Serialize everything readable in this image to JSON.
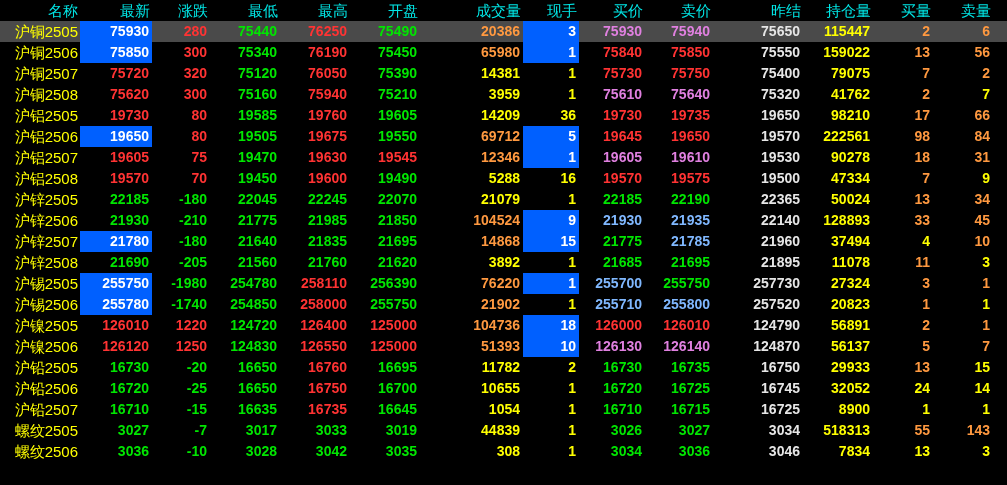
{
  "columns": [
    "名称",
    "最新",
    "涨跌",
    "最低",
    "最高",
    "开盘",
    "成交量",
    "现手",
    "买价",
    "卖价",
    "昨结",
    "持仓量",
    "买量",
    "卖量"
  ],
  "rows": [
    {
      "name": "沪铜2505",
      "selected": true,
      "latest_highlighted": true,
      "hand_highlighted": true,
      "cells": [
        {
          "text": "75930",
          "color": "#ffffff"
        },
        {
          "text": "280",
          "color": "#ff3333"
        },
        {
          "text": "75440",
          "color": "#00e600"
        },
        {
          "text": "76250",
          "color": "#ff3333"
        },
        {
          "text": "75490",
          "color": "#00e600"
        },
        {
          "text": "20386",
          "color": "#ff9940"
        },
        {
          "text": "3",
          "color": "#ffffff"
        },
        {
          "text": "75930",
          "color": "#e080e0"
        },
        {
          "text": "75940",
          "color": "#e080e0"
        },
        {
          "text": "75650",
          "color": "#e6e6e6"
        },
        {
          "text": "115447",
          "color": "#ffff00"
        },
        {
          "text": "2",
          "color": "#ff9940"
        },
        {
          "text": "6",
          "color": "#ff9940"
        }
      ]
    },
    {
      "name": "沪铜2506",
      "selected": false,
      "latest_highlighted": true,
      "hand_highlighted": true,
      "cells": [
        {
          "text": "75850",
          "color": "#ffffff"
        },
        {
          "text": "300",
          "color": "#ff3333"
        },
        {
          "text": "75340",
          "color": "#00e600"
        },
        {
          "text": "76190",
          "color": "#ff3333"
        },
        {
          "text": "75450",
          "color": "#00e600"
        },
        {
          "text": "65980",
          "color": "#ff9940"
        },
        {
          "text": "1",
          "color": "#ffffff"
        },
        {
          "text": "75840",
          "color": "#ff3333"
        },
        {
          "text": "75850",
          "color": "#ff3333"
        },
        {
          "text": "75550",
          "color": "#e6e6e6"
        },
        {
          "text": "159022",
          "color": "#ffff00"
        },
        {
          "text": "13",
          "color": "#ff9940"
        },
        {
          "text": "56",
          "color": "#ff9940"
        }
      ]
    },
    {
      "name": "沪铜2507",
      "selected": false,
      "latest_highlighted": false,
      "hand_highlighted": false,
      "cells": [
        {
          "text": "75720",
          "color": "#ff3333"
        },
        {
          "text": "320",
          "color": "#ff3333"
        },
        {
          "text": "75120",
          "color": "#00e600"
        },
        {
          "text": "76050",
          "color": "#ff3333"
        },
        {
          "text": "75390",
          "color": "#00e600"
        },
        {
          "text": "14381",
          "color": "#ffff00"
        },
        {
          "text": "1",
          "color": "#ffff00"
        },
        {
          "text": "75730",
          "color": "#ff3333"
        },
        {
          "text": "75750",
          "color": "#ff3333"
        },
        {
          "text": "75400",
          "color": "#e6e6e6"
        },
        {
          "text": "79075",
          "color": "#ffff00"
        },
        {
          "text": "7",
          "color": "#ff9940"
        },
        {
          "text": "2",
          "color": "#ff9940"
        }
      ]
    },
    {
      "name": "沪铜2508",
      "selected": false,
      "latest_highlighted": false,
      "hand_highlighted": false,
      "cells": [
        {
          "text": "75620",
          "color": "#ff3333"
        },
        {
          "text": "300",
          "color": "#ff3333"
        },
        {
          "text": "75160",
          "color": "#00e600"
        },
        {
          "text": "75940",
          "color": "#ff3333"
        },
        {
          "text": "75210",
          "color": "#00e600"
        },
        {
          "text": "3959",
          "color": "#ffff00"
        },
        {
          "text": "1",
          "color": "#ffff00"
        },
        {
          "text": "75610",
          "color": "#e080e0"
        },
        {
          "text": "75640",
          "color": "#e080e0"
        },
        {
          "text": "75320",
          "color": "#e6e6e6"
        },
        {
          "text": "41762",
          "color": "#ffff00"
        },
        {
          "text": "2",
          "color": "#ff9940"
        },
        {
          "text": "7",
          "color": "#ffff00"
        }
      ]
    },
    {
      "name": "沪铝2505",
      "selected": false,
      "latest_highlighted": false,
      "hand_highlighted": false,
      "cells": [
        {
          "text": "19730",
          "color": "#ff3333"
        },
        {
          "text": "80",
          "color": "#ff3333"
        },
        {
          "text": "19585",
          "color": "#00e600"
        },
        {
          "text": "19760",
          "color": "#ff3333"
        },
        {
          "text": "19605",
          "color": "#00e600"
        },
        {
          "text": "14209",
          "color": "#ffff00"
        },
        {
          "text": "36",
          "color": "#ffff00"
        },
        {
          "text": "19730",
          "color": "#ff3333"
        },
        {
          "text": "19735",
          "color": "#ff3333"
        },
        {
          "text": "19650",
          "color": "#e6e6e6"
        },
        {
          "text": "98210",
          "color": "#ffff00"
        },
        {
          "text": "17",
          "color": "#ff9940"
        },
        {
          "text": "66",
          "color": "#ff9940"
        }
      ]
    },
    {
      "name": "沪铝2506",
      "selected": false,
      "latest_highlighted": true,
      "hand_highlighted": true,
      "cells": [
        {
          "text": "19650",
          "color": "#ffffff"
        },
        {
          "text": "80",
          "color": "#ff3333"
        },
        {
          "text": "19505",
          "color": "#00e600"
        },
        {
          "text": "19675",
          "color": "#ff3333"
        },
        {
          "text": "19550",
          "color": "#00e600"
        },
        {
          "text": "69712",
          "color": "#ff9940"
        },
        {
          "text": "5",
          "color": "#ffffff"
        },
        {
          "text": "19645",
          "color": "#ff3333"
        },
        {
          "text": "19650",
          "color": "#ff3333"
        },
        {
          "text": "19570",
          "color": "#e6e6e6"
        },
        {
          "text": "222561",
          "color": "#ffff00"
        },
        {
          "text": "98",
          "color": "#ff9940"
        },
        {
          "text": "84",
          "color": "#ff9940"
        }
      ]
    },
    {
      "name": "沪铝2507",
      "selected": false,
      "latest_highlighted": false,
      "hand_highlighted": true,
      "cells": [
        {
          "text": "19605",
          "color": "#ff3333"
        },
        {
          "text": "75",
          "color": "#ff3333"
        },
        {
          "text": "19470",
          "color": "#00e600"
        },
        {
          "text": "19630",
          "color": "#ff3333"
        },
        {
          "text": "19545",
          "color": "#ff3333"
        },
        {
          "text": "12346",
          "color": "#ff9940"
        },
        {
          "text": "1",
          "color": "#ffffff"
        },
        {
          "text": "19605",
          "color": "#e080e0"
        },
        {
          "text": "19610",
          "color": "#e080e0"
        },
        {
          "text": "19530",
          "color": "#e6e6e6"
        },
        {
          "text": "90278",
          "color": "#ffff00"
        },
        {
          "text": "18",
          "color": "#ff9940"
        },
        {
          "text": "31",
          "color": "#ff9940"
        }
      ]
    },
    {
      "name": "沪铝2508",
      "selected": false,
      "latest_highlighted": false,
      "hand_highlighted": false,
      "cells": [
        {
          "text": "19570",
          "color": "#ff3333"
        },
        {
          "text": "70",
          "color": "#ff3333"
        },
        {
          "text": "19450",
          "color": "#00e600"
        },
        {
          "text": "19600",
          "color": "#ff3333"
        },
        {
          "text": "19490",
          "color": "#00e600"
        },
        {
          "text": "5288",
          "color": "#ffff00"
        },
        {
          "text": "16",
          "color": "#ffff00"
        },
        {
          "text": "19570",
          "color": "#ff3333"
        },
        {
          "text": "19575",
          "color": "#ff3333"
        },
        {
          "text": "19500",
          "color": "#e6e6e6"
        },
        {
          "text": "47334",
          "color": "#ffff00"
        },
        {
          "text": "7",
          "color": "#ff9940"
        },
        {
          "text": "9",
          "color": "#ffff00"
        }
      ]
    },
    {
      "name": "沪锌2505",
      "selected": false,
      "latest_highlighted": false,
      "hand_highlighted": false,
      "cells": [
        {
          "text": "22185",
          "color": "#00e600"
        },
        {
          "text": "-180",
          "color": "#00e600"
        },
        {
          "text": "22045",
          "color": "#00e600"
        },
        {
          "text": "22245",
          "color": "#00e600"
        },
        {
          "text": "22070",
          "color": "#00e600"
        },
        {
          "text": "21079",
          "color": "#ffff00"
        },
        {
          "text": "1",
          "color": "#ffff00"
        },
        {
          "text": "22185",
          "color": "#00e600"
        },
        {
          "text": "22190",
          "color": "#00e600"
        },
        {
          "text": "22365",
          "color": "#e6e6e6"
        },
        {
          "text": "50024",
          "color": "#ffff00"
        },
        {
          "text": "13",
          "color": "#ff9940"
        },
        {
          "text": "34",
          "color": "#ff9940"
        }
      ]
    },
    {
      "name": "沪锌2506",
      "selected": false,
      "latest_highlighted": false,
      "hand_highlighted": true,
      "cells": [
        {
          "text": "21930",
          "color": "#00e600"
        },
        {
          "text": "-210",
          "color": "#00e600"
        },
        {
          "text": "21775",
          "color": "#00e600"
        },
        {
          "text": "21985",
          "color": "#00e600"
        },
        {
          "text": "21850",
          "color": "#00e600"
        },
        {
          "text": "104524",
          "color": "#ff9940"
        },
        {
          "text": "9",
          "color": "#ffffff"
        },
        {
          "text": "21930",
          "color": "#80b8ff"
        },
        {
          "text": "21935",
          "color": "#80b8ff"
        },
        {
          "text": "22140",
          "color": "#e6e6e6"
        },
        {
          "text": "128893",
          "color": "#ffff00"
        },
        {
          "text": "33",
          "color": "#ff9940"
        },
        {
          "text": "45",
          "color": "#ff9940"
        }
      ]
    },
    {
      "name": "沪锌2507",
      "selected": false,
      "latest_highlighted": true,
      "hand_highlighted": true,
      "cells": [
        {
          "text": "21780",
          "color": "#ffffff"
        },
        {
          "text": "-180",
          "color": "#00e600"
        },
        {
          "text": "21640",
          "color": "#00e600"
        },
        {
          "text": "21835",
          "color": "#00e600"
        },
        {
          "text": "21695",
          "color": "#00e600"
        },
        {
          "text": "14868",
          "color": "#ff9940"
        },
        {
          "text": "15",
          "color": "#ffffff"
        },
        {
          "text": "21775",
          "color": "#00e600"
        },
        {
          "text": "21785",
          "color": "#80b8ff"
        },
        {
          "text": "21960",
          "color": "#e6e6e6"
        },
        {
          "text": "37494",
          "color": "#ffff00"
        },
        {
          "text": "4",
          "color": "#ffff00"
        },
        {
          "text": "10",
          "color": "#ff9940"
        }
      ]
    },
    {
      "name": "沪锌2508",
      "selected": false,
      "latest_highlighted": false,
      "hand_highlighted": false,
      "cells": [
        {
          "text": "21690",
          "color": "#00e600"
        },
        {
          "text": "-205",
          "color": "#00e600"
        },
        {
          "text": "21560",
          "color": "#00e600"
        },
        {
          "text": "21760",
          "color": "#00e600"
        },
        {
          "text": "21620",
          "color": "#00e600"
        },
        {
          "text": "3892",
          "color": "#ffff00"
        },
        {
          "text": "1",
          "color": "#ffff00"
        },
        {
          "text": "21685",
          "color": "#00e600"
        },
        {
          "text": "21695",
          "color": "#00e600"
        },
        {
          "text": "21895",
          "color": "#e6e6e6"
        },
        {
          "text": "11078",
          "color": "#ffff00"
        },
        {
          "text": "11",
          "color": "#ff9940"
        },
        {
          "text": "3",
          "color": "#ffff00"
        }
      ]
    },
    {
      "name": "沪锡2505",
      "selected": false,
      "latest_highlighted": true,
      "hand_highlighted": true,
      "cells": [
        {
          "text": "255750",
          "color": "#ffffff"
        },
        {
          "text": "-1980",
          "color": "#00e600"
        },
        {
          "text": "254780",
          "color": "#00e600"
        },
        {
          "text": "258110",
          "color": "#ff3333"
        },
        {
          "text": "256390",
          "color": "#00e600"
        },
        {
          "text": "76220",
          "color": "#ff9940"
        },
        {
          "text": "1",
          "color": "#ffffff"
        },
        {
          "text": "255700",
          "color": "#80b8ff"
        },
        {
          "text": "255750",
          "color": "#00e600"
        },
        {
          "text": "257730",
          "color": "#e6e6e6"
        },
        {
          "text": "27324",
          "color": "#ffff00"
        },
        {
          "text": "3",
          "color": "#ff9940"
        },
        {
          "text": "1",
          "color": "#ff9940"
        }
      ]
    },
    {
      "name": "沪锡2506",
      "selected": false,
      "latest_highlighted": true,
      "hand_highlighted": false,
      "cells": [
        {
          "text": "255780",
          "color": "#ffffff"
        },
        {
          "text": "-1740",
          "color": "#00e600"
        },
        {
          "text": "254850",
          "color": "#00e600"
        },
        {
          "text": "258000",
          "color": "#ff3333"
        },
        {
          "text": "255750",
          "color": "#00e600"
        },
        {
          "text": "21902",
          "color": "#ff9940"
        },
        {
          "text": "1",
          "color": "#ffff00"
        },
        {
          "text": "255710",
          "color": "#80b8ff"
        },
        {
          "text": "255800",
          "color": "#80b8ff"
        },
        {
          "text": "257520",
          "color": "#e6e6e6"
        },
        {
          "text": "20823",
          "color": "#ffff00"
        },
        {
          "text": "1",
          "color": "#ff9940"
        },
        {
          "text": "1",
          "color": "#ffff00"
        }
      ]
    },
    {
      "name": "沪镍2505",
      "selected": false,
      "latest_highlighted": false,
      "hand_highlighted": true,
      "cells": [
        {
          "text": "126010",
          "color": "#ff3333"
        },
        {
          "text": "1220",
          "color": "#ff3333"
        },
        {
          "text": "124720",
          "color": "#00e600"
        },
        {
          "text": "126400",
          "color": "#ff3333"
        },
        {
          "text": "125000",
          "color": "#ff3333"
        },
        {
          "text": "104736",
          "color": "#ff9940"
        },
        {
          "text": "18",
          "color": "#ffffff"
        },
        {
          "text": "126000",
          "color": "#ff3333"
        },
        {
          "text": "126010",
          "color": "#ff3333"
        },
        {
          "text": "124790",
          "color": "#e6e6e6"
        },
        {
          "text": "56891",
          "color": "#ffff00"
        },
        {
          "text": "2",
          "color": "#ff9940"
        },
        {
          "text": "1",
          "color": "#ff9940"
        }
      ]
    },
    {
      "name": "沪镍2506",
      "selected": false,
      "latest_highlighted": false,
      "hand_highlighted": true,
      "cells": [
        {
          "text": "126120",
          "color": "#ff3333"
        },
        {
          "text": "1250",
          "color": "#ff3333"
        },
        {
          "text": "124830",
          "color": "#00e600"
        },
        {
          "text": "126550",
          "color": "#ff3333"
        },
        {
          "text": "125000",
          "color": "#ff3333"
        },
        {
          "text": "51393",
          "color": "#ff9940"
        },
        {
          "text": "10",
          "color": "#ffffff"
        },
        {
          "text": "126130",
          "color": "#e080e0"
        },
        {
          "text": "126140",
          "color": "#e080e0"
        },
        {
          "text": "124870",
          "color": "#e6e6e6"
        },
        {
          "text": "56137",
          "color": "#ffff00"
        },
        {
          "text": "5",
          "color": "#ff9940"
        },
        {
          "text": "7",
          "color": "#ff9940"
        }
      ]
    },
    {
      "name": "沪铅2505",
      "selected": false,
      "latest_highlighted": false,
      "hand_highlighted": false,
      "cells": [
        {
          "text": "16730",
          "color": "#00e600"
        },
        {
          "text": "-20",
          "color": "#00e600"
        },
        {
          "text": "16650",
          "color": "#00e600"
        },
        {
          "text": "16760",
          "color": "#ff3333"
        },
        {
          "text": "16695",
          "color": "#00e600"
        },
        {
          "text": "11782",
          "color": "#ffff00"
        },
        {
          "text": "2",
          "color": "#ffff00"
        },
        {
          "text": "16730",
          "color": "#00e600"
        },
        {
          "text": "16735",
          "color": "#00e600"
        },
        {
          "text": "16750",
          "color": "#e6e6e6"
        },
        {
          "text": "29933",
          "color": "#ffff00"
        },
        {
          "text": "13",
          "color": "#ff9940"
        },
        {
          "text": "15",
          "color": "#ffff00"
        }
      ]
    },
    {
      "name": "沪铅2506",
      "selected": false,
      "latest_highlighted": false,
      "hand_highlighted": false,
      "cells": [
        {
          "text": "16720",
          "color": "#00e600"
        },
        {
          "text": "-25",
          "color": "#00e600"
        },
        {
          "text": "16650",
          "color": "#00e600"
        },
        {
          "text": "16750",
          "color": "#ff3333"
        },
        {
          "text": "16700",
          "color": "#00e600"
        },
        {
          "text": "10655",
          "color": "#ffff00"
        },
        {
          "text": "1",
          "color": "#ffff00"
        },
        {
          "text": "16720",
          "color": "#00e600"
        },
        {
          "text": "16725",
          "color": "#00e600"
        },
        {
          "text": "16745",
          "color": "#e6e6e6"
        },
        {
          "text": "32052",
          "color": "#ffff00"
        },
        {
          "text": "24",
          "color": "#ffff00"
        },
        {
          "text": "14",
          "color": "#ffff00"
        }
      ]
    },
    {
      "name": "沪铅2507",
      "selected": false,
      "latest_highlighted": false,
      "hand_highlighted": false,
      "cells": [
        {
          "text": "16710",
          "color": "#00e600"
        },
        {
          "text": "-15",
          "color": "#00e600"
        },
        {
          "text": "16635",
          "color": "#00e600"
        },
        {
          "text": "16735",
          "color": "#ff3333"
        },
        {
          "text": "16645",
          "color": "#00e600"
        },
        {
          "text": "1054",
          "color": "#ffff00"
        },
        {
          "text": "1",
          "color": "#ffff00"
        },
        {
          "text": "16710",
          "color": "#00e600"
        },
        {
          "text": "16715",
          "color": "#00e600"
        },
        {
          "text": "16725",
          "color": "#e6e6e6"
        },
        {
          "text": "8900",
          "color": "#ffff00"
        },
        {
          "text": "1",
          "color": "#ffff00"
        },
        {
          "text": "1",
          "color": "#ffff00"
        }
      ]
    },
    {
      "name": "螺纹2505",
      "selected": false,
      "latest_highlighted": false,
      "hand_highlighted": false,
      "cells": [
        {
          "text": "3027",
          "color": "#00e600"
        },
        {
          "text": "-7",
          "color": "#00e600"
        },
        {
          "text": "3017",
          "color": "#00e600"
        },
        {
          "text": "3033",
          "color": "#00e600"
        },
        {
          "text": "3019",
          "color": "#00e600"
        },
        {
          "text": "44839",
          "color": "#ffff00"
        },
        {
          "text": "1",
          "color": "#ffff00"
        },
        {
          "text": "3026",
          "color": "#00e600"
        },
        {
          "text": "3027",
          "color": "#00e600"
        },
        {
          "text": "3034",
          "color": "#e6e6e6"
        },
        {
          "text": "518313",
          "color": "#ffff00"
        },
        {
          "text": "55",
          "color": "#ff9940"
        },
        {
          "text": "143",
          "color": "#ff9940"
        }
      ]
    },
    {
      "name": "螺纹2506",
      "selected": false,
      "latest_highlighted": false,
      "hand_highlighted": false,
      "cells": [
        {
          "text": "3036",
          "color": "#00e600"
        },
        {
          "text": "-10",
          "color": "#00e600"
        },
        {
          "text": "3028",
          "color": "#00e600"
        },
        {
          "text": "3042",
          "color": "#00e600"
        },
        {
          "text": "3035",
          "color": "#00e600"
        },
        {
          "text": "308",
          "color": "#ffff00"
        },
        {
          "text": "1",
          "color": "#ffff00"
        },
        {
          "text": "3034",
          "color": "#00e600"
        },
        {
          "text": "3036",
          "color": "#00e600"
        },
        {
          "text": "3046",
          "color": "#e6e6e6"
        },
        {
          "text": "7834",
          "color": "#ffff00"
        },
        {
          "text": "13",
          "color": "#ffff00"
        },
        {
          "text": "3",
          "color": "#ffff00"
        }
      ]
    }
  ]
}
